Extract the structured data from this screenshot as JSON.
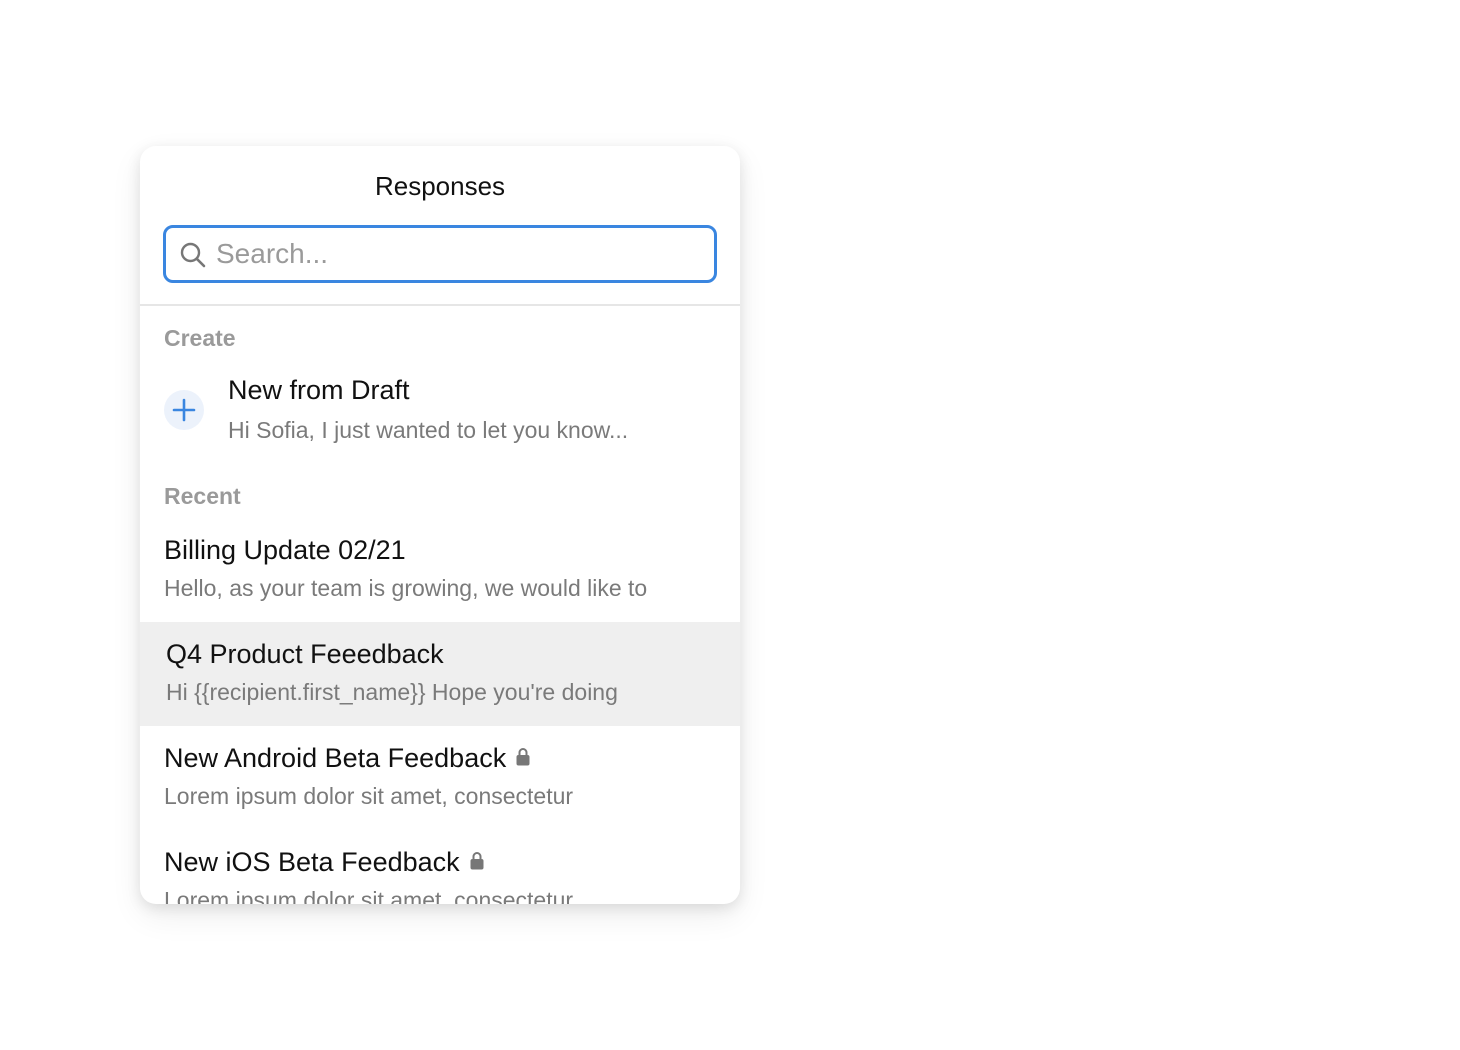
{
  "panel": {
    "title": "Responses",
    "search": {
      "placeholder": "Search...",
      "value": ""
    },
    "sections": {
      "create_label": "Create",
      "recent_label": "Recent"
    },
    "create_item": {
      "icon": "plus-icon",
      "title": "New from Draft",
      "preview": "Hi Sofia, I just wanted to let you know..."
    },
    "recent_items": [
      {
        "title": "Billing Update 02/21",
        "preview": "Hello, as your team is growing, we would like to",
        "locked": false,
        "selected": false
      },
      {
        "title": "Q4 Product Feeedback",
        "preview": "Hi {{recipient.first_name}} Hope you're doing",
        "locked": false,
        "selected": true
      },
      {
        "title": "New Android Beta Feedback",
        "preview": "Lorem ipsum dolor sit amet, consectetur",
        "locked": true,
        "selected": false
      },
      {
        "title": "New iOS Beta Feedback",
        "preview": "Lorem ipsum dolor sit amet, consectetur",
        "locked": true,
        "selected": false
      }
    ]
  },
  "colors": {
    "accent": "#3a86e0",
    "selected_row": "#efefef",
    "muted_text": "#7a7a7a"
  }
}
